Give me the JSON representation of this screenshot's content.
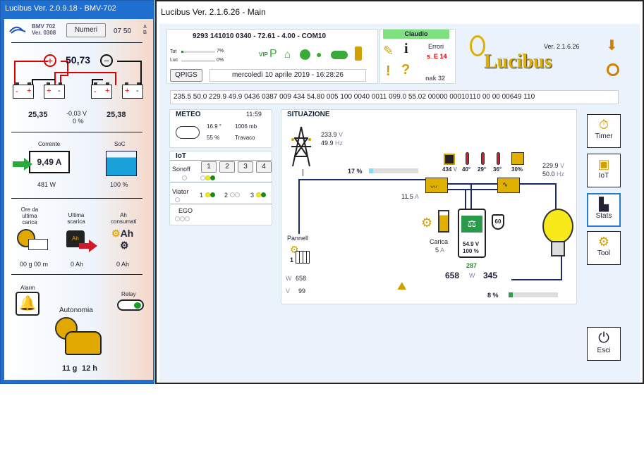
{
  "left_window": {
    "title": "Lucibus Ver. 2.0.9.18 - BMV-702",
    "device_name": "BMV 702",
    "device_ver": "Ver. 0308",
    "numeri_button": "Numeri",
    "clock": "07 50",
    "ab_a": "A",
    "ab_b": "B",
    "voltage_total": "50,73",
    "plus": "+",
    "minus": "−",
    "batt_left_v": "25,35",
    "mid_v": "-0,03 V",
    "mid_pct": "0 %",
    "batt_right_v": "25,38",
    "corrente_label": "Corrente",
    "corrente_value": "9,49 A",
    "watt": "481 W",
    "soc_label": "SoC",
    "soc_value": "100 %",
    "ore_label": "Ore da ultima carica",
    "ore_value": "00 g 00 m",
    "ultima_label": "Ultima scarica",
    "ultima_value": "0 Ah",
    "ah_label": "Ah consumati",
    "ah_value": "0 Ah",
    "ah_icon_text": "Ah",
    "weight_text": "Ah",
    "alarm_label": "Alarm",
    "relay_label": "Relay",
    "autonomia_label": "Autonomia",
    "aut_days": "11 g",
    "aut_hours": "12 h"
  },
  "main_window": {
    "title": "Lucibus Ver. 2.1.6.26 - Main",
    "header_line": "9293 141010 0340  -  72.61 - 4.00  -  COM10",
    "tot_label": "Tot",
    "tot_pct": "7%",
    "luc_label": "Luc",
    "luc_pct": "0%",
    "vip": "VIP",
    "qpigs_button": "QPIGS",
    "datetime": "mercoledì 10 aprile 2019 - 16:28:26",
    "user": "Claudio",
    "errori_label": "Errori",
    "errori_value": "s_E 14",
    "nak": "nak 32",
    "logo_text": "Lucibus",
    "logo_ver": "Ver. 2.1.6.26",
    "data_string": "235.5 50.0 229.9 49.9 0436 0387 009 434 54.80 005 100 0040 0011 099.0 55.02 00000 00010110 00 00 00649 110",
    "meteo": {
      "label": "METEO",
      "time": "11:59",
      "temp": "16.9 °",
      "pressure": "1006 mb",
      "humidity": "55 %",
      "place": "Travaco"
    },
    "iot": {
      "label": "IoT",
      "sonoff_label": "Sonoff",
      "sonoff_buttons": [
        "1",
        "2",
        "3",
        "4"
      ],
      "viator_label": "Viator",
      "viator_nums": [
        "1",
        "2",
        "3"
      ],
      "ego_label": "EGO"
    },
    "situazione": {
      "label": "SITUAZIONE",
      "grid_v": "233.9",
      "grid_v_unit": "V",
      "grid_hz": "49.9",
      "grid_hz_unit": "Hz",
      "pv_pct": "17 %",
      "pv_current": "11.5",
      "pv_current_unit": "A",
      "temp_dc_v": "434",
      "temp_dc_unit": "V",
      "temp1": "40°",
      "temp2": "29°",
      "temp3": "36°",
      "fan_pct": "30%",
      "out_v": "229.9",
      "out_v_unit": "V",
      "out_hz": "50.0",
      "out_hz_unit": "Hz",
      "carica_label": "Carica",
      "carica_a": "5",
      "carica_unit": "A",
      "batt_v": "54.9 V",
      "batt_pct": "100 %",
      "batt_number": "287",
      "shield_num": "60",
      "pannell_label": "Pannell",
      "pannell_num": "1",
      "w_label": "W",
      "pv_w": "658",
      "v_label": "V",
      "pv_v": "99",
      "load_w_left": "658",
      "load_w_label": "W",
      "load_w_right": "345",
      "load_pct": "8 %"
    },
    "side_buttons": {
      "timer": "Timer",
      "iot": "IoT",
      "stats": "Stats",
      "tool": "Tool",
      "esci": "Esci"
    }
  },
  "colors": {
    "green_dot": "#1a8a1a",
    "yellow_dot": "#f2ea1a",
    "user_bg": "#7ee07e",
    "accent_blue": "#1f6fd0"
  }
}
